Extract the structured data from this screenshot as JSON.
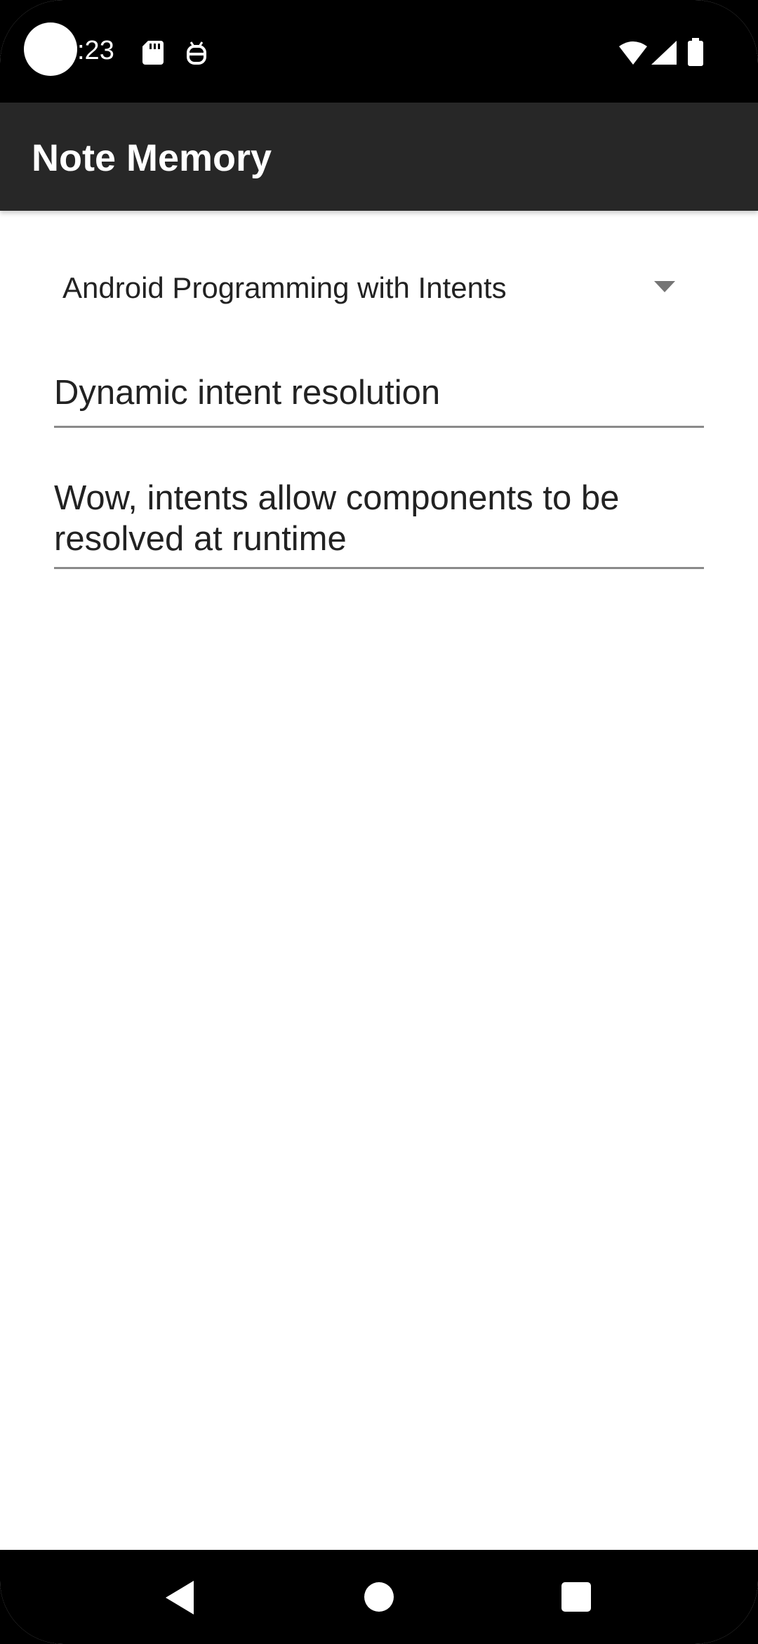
{
  "status_bar": {
    "time": ":23",
    "icons": [
      "sd-card-icon",
      "robot-icon",
      "wifi-icon",
      "signal-icon",
      "battery-icon"
    ]
  },
  "app_bar": {
    "title": "Note Memory"
  },
  "spinner": {
    "selected": "Android Programming with Intents"
  },
  "note": {
    "title_value": "Dynamic intent resolution",
    "body_value": "Wow, intents allow components to be\nresolved at runtime"
  },
  "nav_bar": {
    "buttons": [
      "back-icon",
      "home-icon",
      "recents-icon"
    ]
  },
  "colors": {
    "app_bar": "#272727",
    "status_bar": "#000000",
    "background": "#ffffff",
    "text": "#222222",
    "underline": "#8a8a8a"
  }
}
